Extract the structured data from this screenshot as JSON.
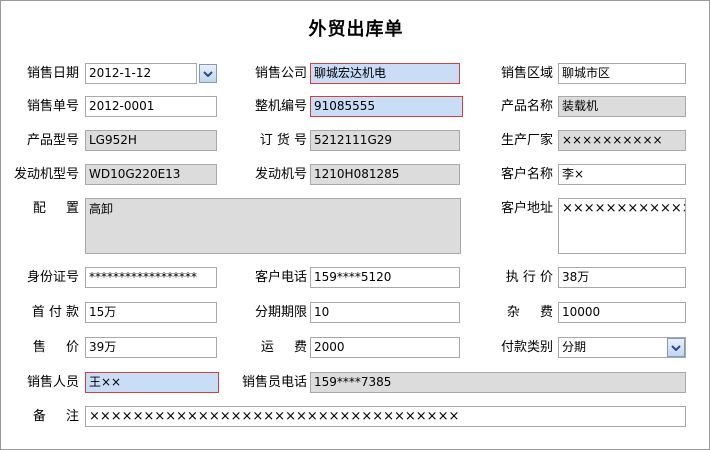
{
  "title": "外贸出库单",
  "fields": {
    "sale_date": {
      "label": "销售日期",
      "value": "2012-1-12"
    },
    "sale_company": {
      "label": "销售公司",
      "value": "聊城宏达机电"
    },
    "sale_region": {
      "label": "销售区域",
      "value": "聊城市区"
    },
    "sale_no": {
      "label": "销售单号",
      "value": "2012-0001"
    },
    "machine_no": {
      "label": "整机编号",
      "value": "91085555"
    },
    "product_name": {
      "label": "产品名称",
      "value": "装载机"
    },
    "product_model": {
      "label": "产品型号",
      "value": "LG952H"
    },
    "order_no": {
      "label": "订 货 号",
      "value": "5212111G29"
    },
    "manufacturer": {
      "label": "生产厂家",
      "value": "××××××××××"
    },
    "engine_model": {
      "label": "发动机型号",
      "value": "WD10G220E13"
    },
    "engine_no": {
      "label": "发动机号",
      "value": "1210H081285"
    },
    "customer_name": {
      "label": "客户名称",
      "value": "李×"
    },
    "config": {
      "label": "配 置",
      "value": "高卸"
    },
    "customer_address": {
      "label": "客户地址",
      "value": "××××××××××××××××"
    },
    "id_no": {
      "label": "身份证号",
      "value": "******************"
    },
    "customer_phone": {
      "label": "客户电话",
      "value": "159****5120"
    },
    "exec_price": {
      "label": "执 行 价",
      "value": "38万"
    },
    "down_payment": {
      "label": "首 付 款",
      "value": "15万"
    },
    "installments": {
      "label": "分期期限",
      "value": "10"
    },
    "misc_fee": {
      "label": "杂 费",
      "value": "10000"
    },
    "price": {
      "label": "售 价",
      "value": "39万"
    },
    "freight": {
      "label": "运 费",
      "value": "2000"
    },
    "payment_type": {
      "label": "付款类别",
      "value": "分期"
    },
    "salesperson": {
      "label": "销售人员",
      "value": "王××"
    },
    "salesperson_phone": {
      "label": "销售员电话",
      "value": "159****7385"
    },
    "remarks": {
      "label": "备 注",
      "value": "××××××××××××××××××××××××××××××××××"
    }
  }
}
